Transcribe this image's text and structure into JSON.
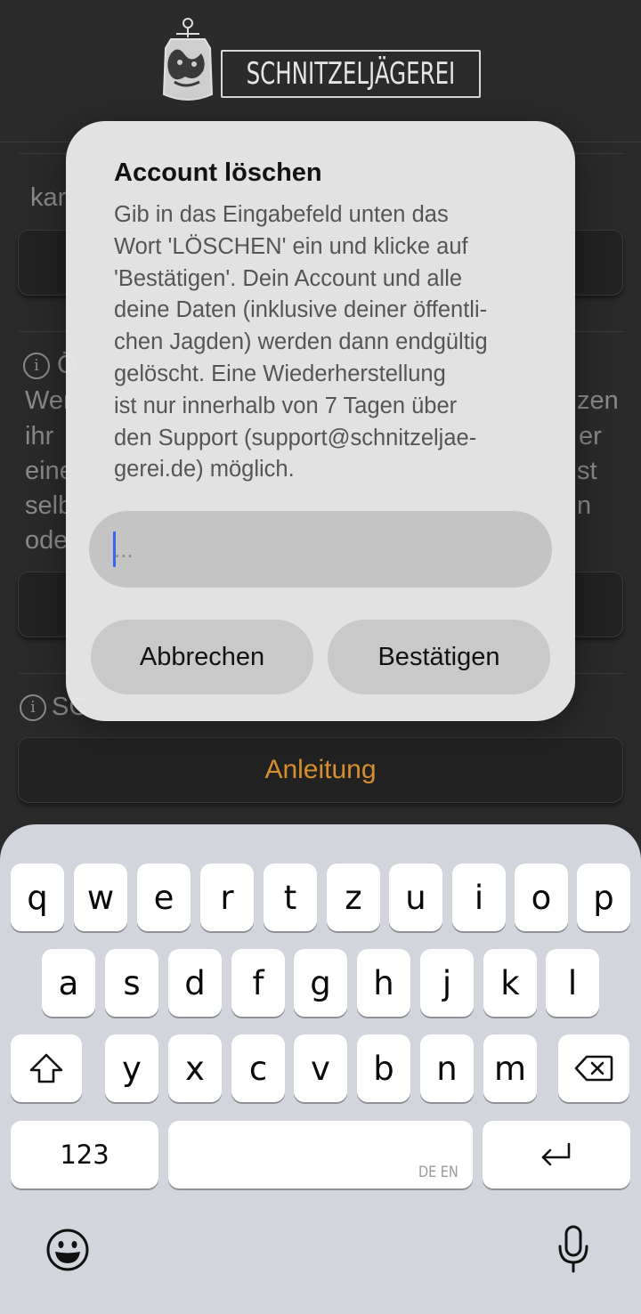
{
  "header": {
    "logo_text": "SCHNITZELJÄGEREI"
  },
  "background": {
    "partial_label_1": "kar",
    "info_line_1_start": "Ö",
    "info_line_2_start": "Wer",
    "info_line_2_end": "zen",
    "info_line_3_start": "ihr",
    "info_line_3_end": "er",
    "info_line_4_start": "eine",
    "info_line_4_end": "st",
    "info_line_5_start": "selb",
    "info_line_5_end": "n",
    "info_line_6_start": "ode",
    "info2_start": "SC",
    "anleitung_label": "Anleitung"
  },
  "dialog": {
    "title": "Account löschen",
    "body_lines": [
      "Gib in das Eingabefeld unten das",
      "Wort 'LÖSCHEN' ein und klicke auf",
      "'Bestätigen'. Dein Account und alle",
      "deine Daten (inklusive deiner öffentli-",
      "chen Jagden) werden dann endgültig",
      "gelöscht. Eine Wiederherstellung",
      "ist nur innerhalb von 7 Tagen über",
      "den Support (support@schnitzeljae-",
      "gerei.de) möglich."
    ],
    "input_placeholder": "...",
    "input_value": "",
    "cancel_label": "Abbrechen",
    "confirm_label": "Bestätigen"
  },
  "keyboard": {
    "row1": [
      "q",
      "w",
      "e",
      "r",
      "t",
      "z",
      "u",
      "i",
      "o",
      "p"
    ],
    "row2": [
      "a",
      "s",
      "d",
      "f",
      "g",
      "h",
      "j",
      "k",
      "l"
    ],
    "row3": [
      "y",
      "x",
      "c",
      "v",
      "b",
      "n",
      "m"
    ],
    "numbers_label": "123",
    "space_lang_hint": "DE EN",
    "icons": [
      "shift-icon",
      "backspace-icon",
      "return-icon",
      "emoji-icon",
      "microphone-icon"
    ]
  }
}
